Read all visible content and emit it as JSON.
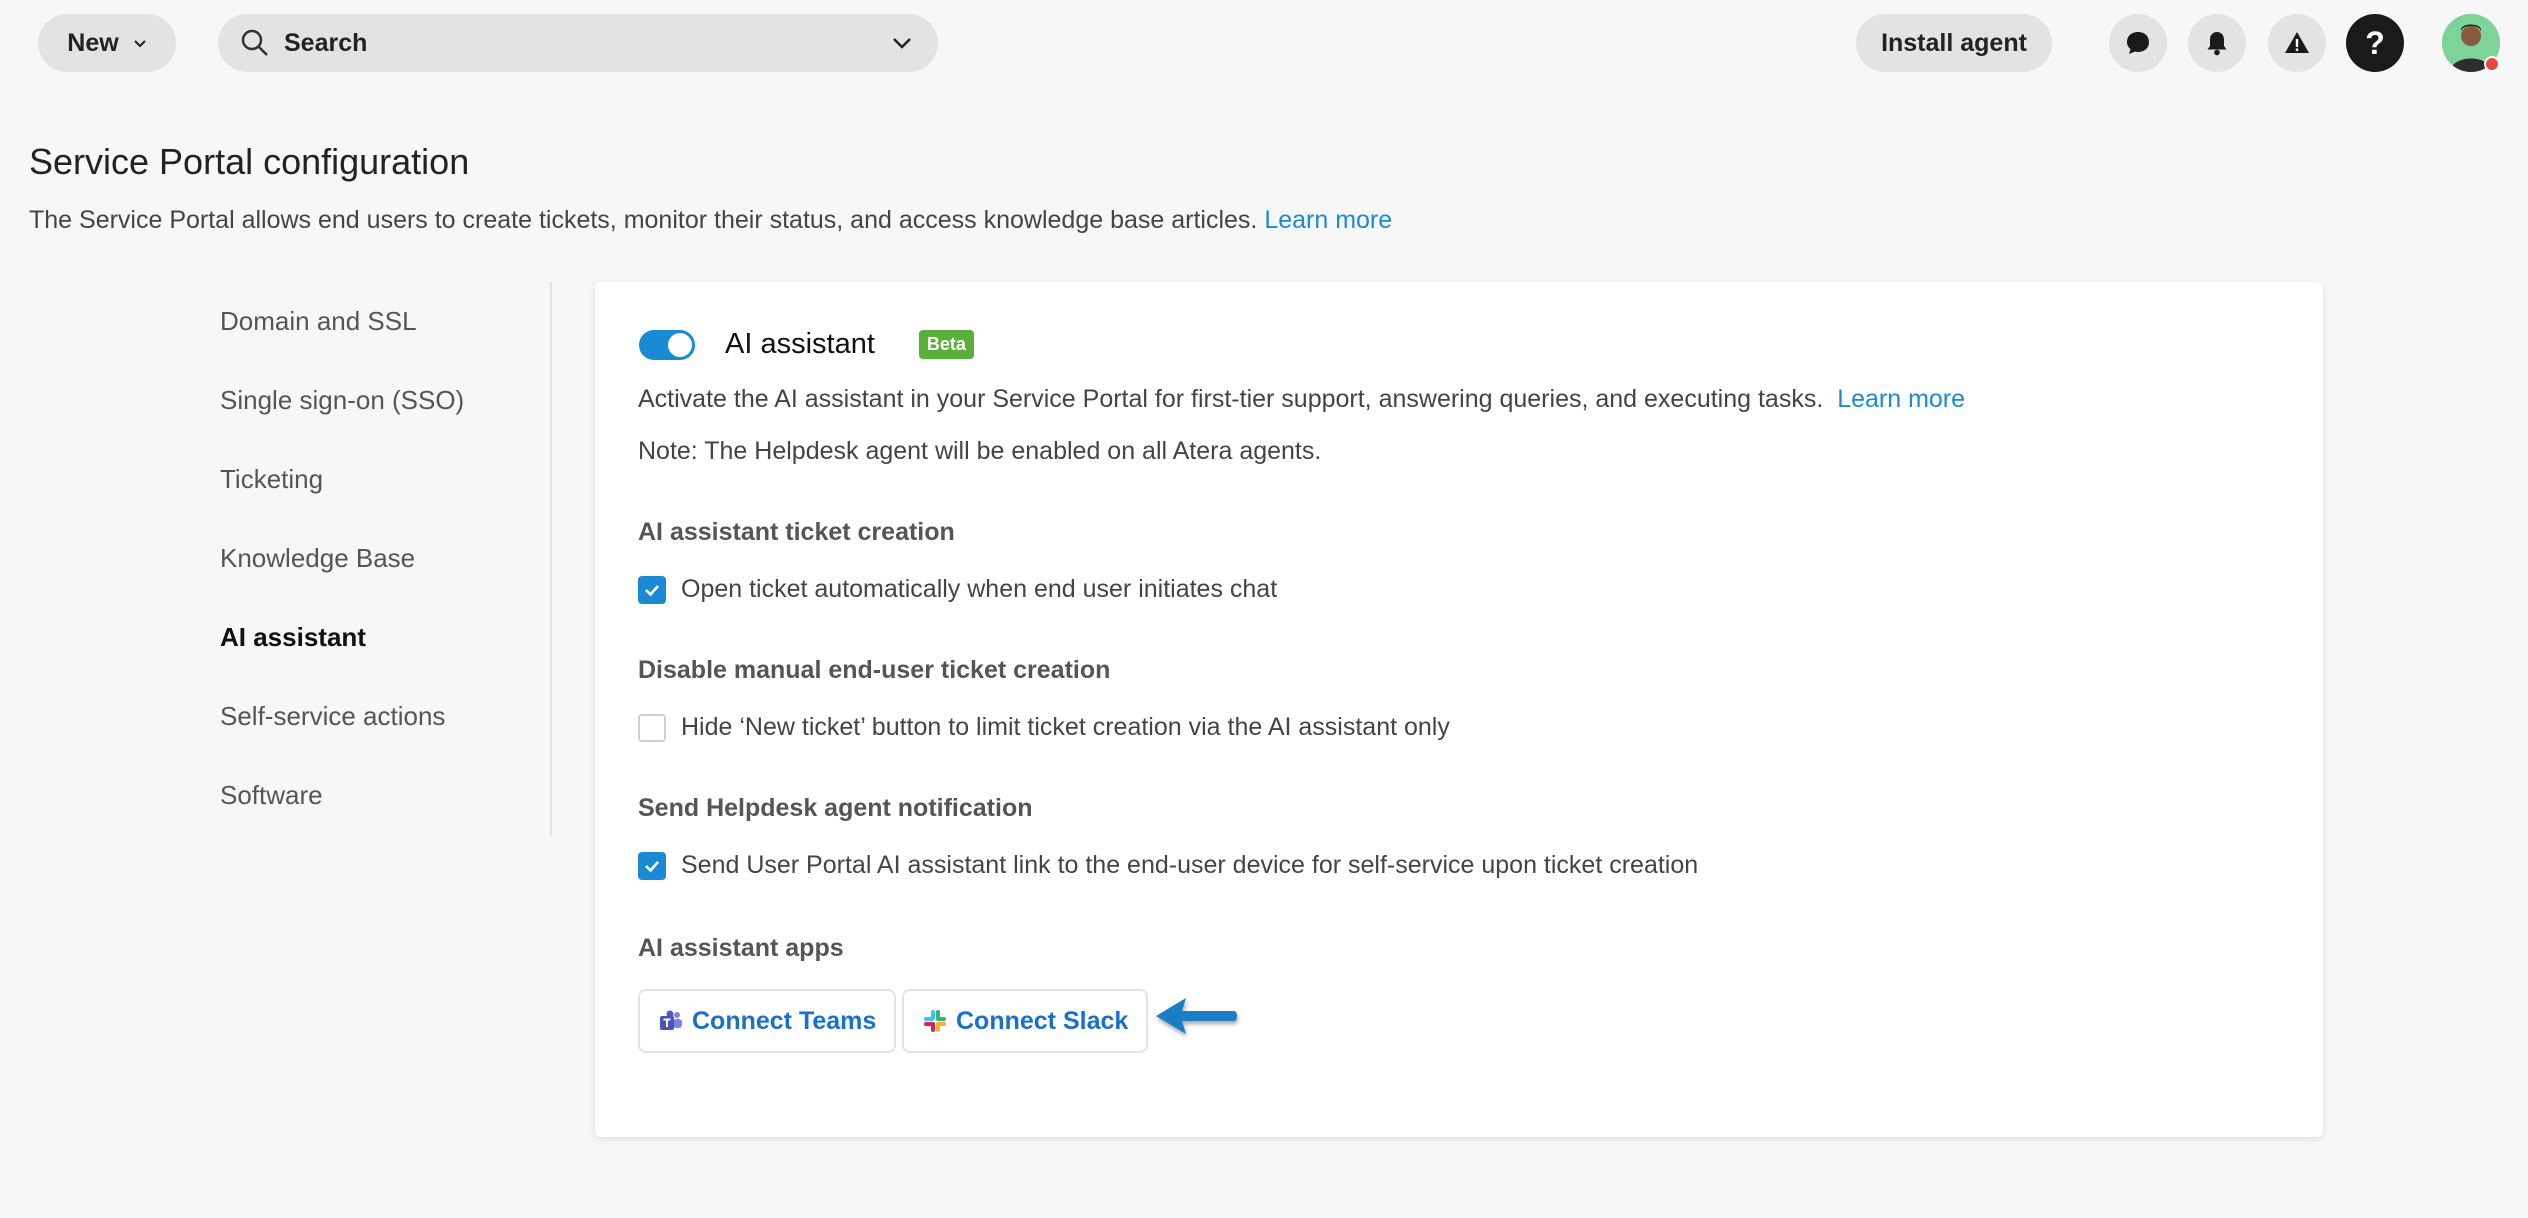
{
  "topbar": {
    "new_label": "New",
    "search_label": "Search",
    "install_label": "Install agent",
    "help_label": "?"
  },
  "page": {
    "title": "Service Portal configuration",
    "description": "The Service Portal allows end users to create tickets, monitor their status, and access knowledge base articles.",
    "learn_more": "Learn more"
  },
  "sidenav": {
    "items": [
      {
        "label": "Domain and SSL"
      },
      {
        "label": "Single sign-on (SSO)"
      },
      {
        "label": "Ticketing"
      },
      {
        "label": "Knowledge Base"
      },
      {
        "label": "AI assistant"
      },
      {
        "label": "Self-service actions"
      },
      {
        "label": "Software"
      }
    ]
  },
  "card": {
    "title": "AI assistant",
    "badge": "Beta",
    "toggle_on": true,
    "activate_text": "Activate the AI assistant in your Service Portal for first-tier support, answering queries, and executing tasks.",
    "learn_more": "Learn more",
    "note": "Note: The Helpdesk agent will be enabled on all Atera agents.",
    "section_ticket_creation": "AI assistant ticket creation",
    "opt_open_ticket": "Open ticket automatically when end user initiates chat",
    "section_disable_manual": "Disable manual end-user ticket creation",
    "opt_hide_new_ticket": "Hide ‘New ticket’ button to limit ticket creation via the AI assistant only",
    "section_notification": "Send Helpdesk agent notification",
    "opt_send_link": "Send User Portal AI assistant link to the end-user device for self-service upon ticket creation",
    "section_apps": "AI assistant apps",
    "connect_teams": "Connect Teams",
    "connect_slack": "Connect Slack"
  },
  "colors": {
    "accent": "#1a8ad4",
    "badge": "#5aae3a",
    "link_button": "#1a6fd0",
    "avatar_status": "#e8473b"
  }
}
